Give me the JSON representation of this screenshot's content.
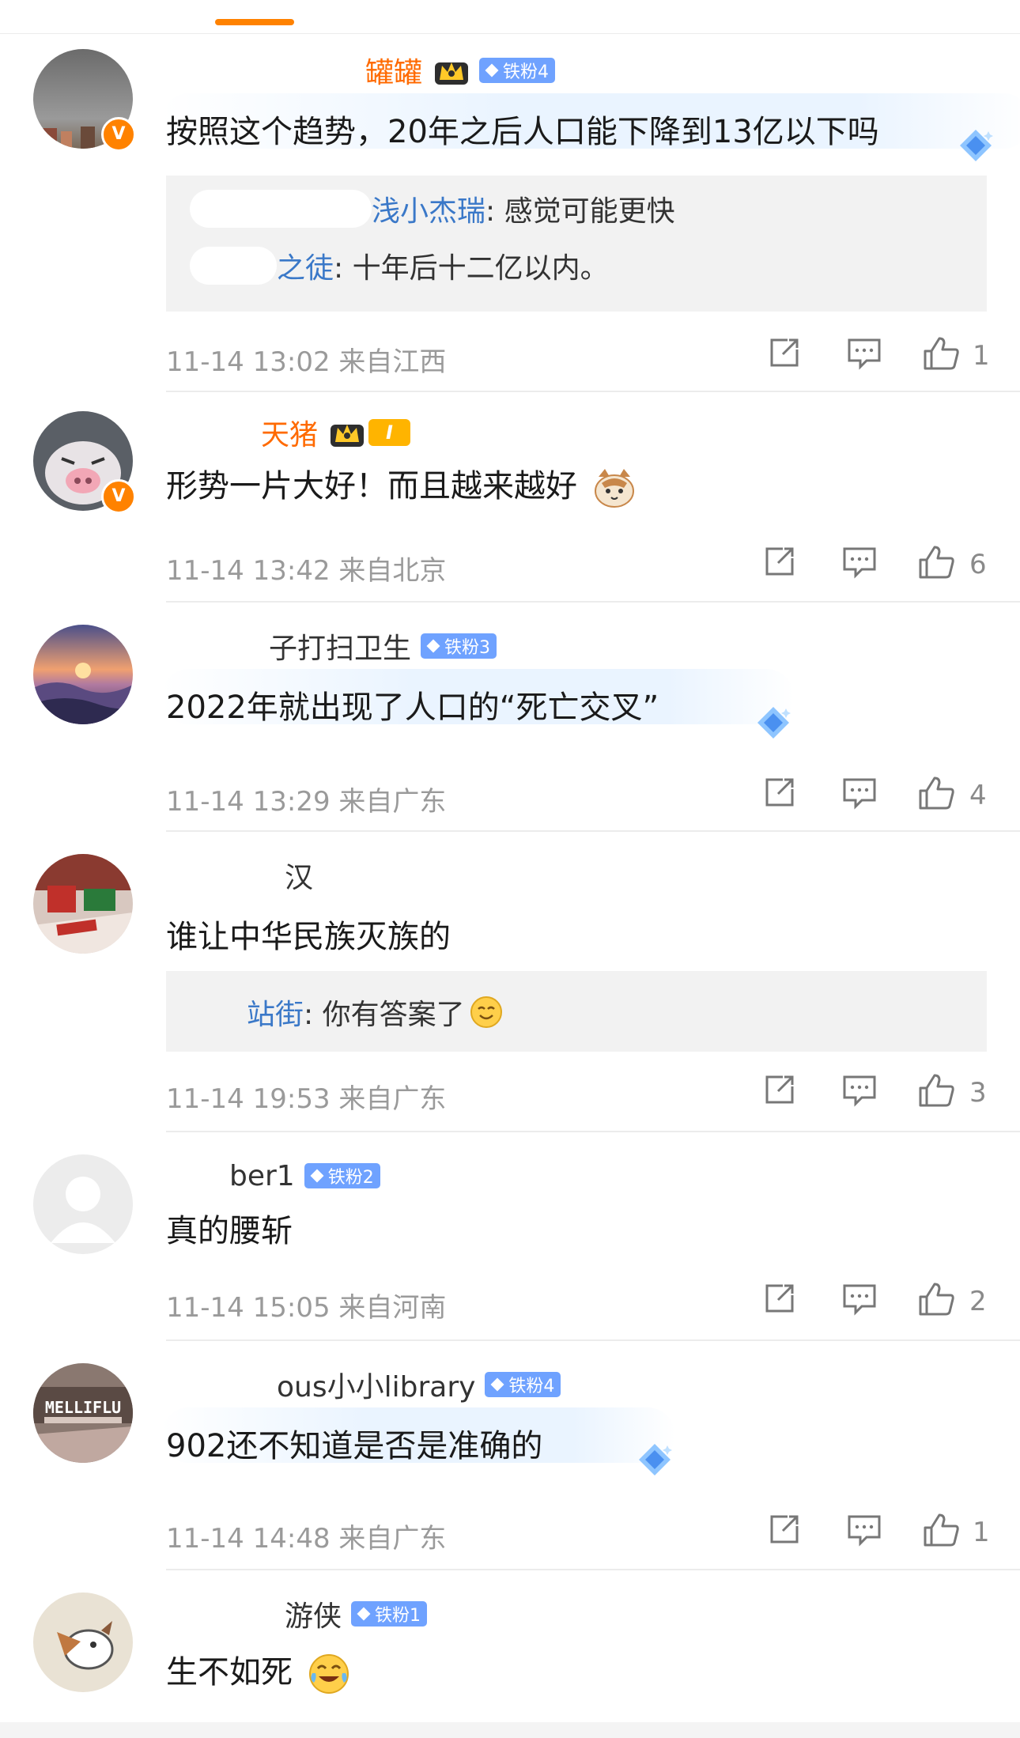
{
  "colors": {
    "accent": "#ff8200",
    "link": "#3a78c8",
    "fan_badge": "#6fa2ff",
    "reply_bg": "#f2f2f2"
  },
  "comments": [
    {
      "username": "罐罐",
      "badges": [
        "铁粉4"
      ],
      "text": "按照这个趋势，20年之后人口能下降到13亿以下吗",
      "replies": [
        {
          "name": "浅小杰瑞",
          "text": ": 感觉可能更快"
        },
        {
          "name": "之徒",
          "text": ": 十年后十二亿以内。"
        }
      ],
      "time": "11-14 13:02",
      "location": "来自江西",
      "likes": "1"
    },
    {
      "username": "天猪",
      "badges": [
        "I"
      ],
      "text": "形势一片大好！而且越来越好",
      "time": "11-14 13:42",
      "location": "来自北京",
      "likes": "6"
    },
    {
      "username": "子打扫卫生",
      "badges": [
        "铁粉3"
      ],
      "text": "2022年就出现了人口的“死亡交叉”",
      "time": "11-14 13:29",
      "location": "来自广东",
      "likes": "4"
    },
    {
      "username": "汉",
      "text": "谁让中华民族灭族的",
      "replies": [
        {
          "name": "站街",
          "text": ": 你有答案了"
        }
      ],
      "time": "11-14 19:53",
      "location": "来自广东",
      "likes": "3"
    },
    {
      "username": "ber1",
      "badges": [
        "铁粉2"
      ],
      "text": "真的腰斩",
      "time": "11-14 15:05",
      "location": "来自河南",
      "likes": "2"
    },
    {
      "username": "ous小小library",
      "badges": [
        "铁粉4"
      ],
      "text": "902还不知道是否是准确的",
      "time": "11-14 14:48",
      "location": "来自广东",
      "likes": "1"
    },
    {
      "username": "游侠",
      "badges": [
        "铁粉1"
      ],
      "text": "生不如死"
    }
  ],
  "icons": {
    "repost": "repost-icon",
    "comment": "comment-icon",
    "like": "like-icon",
    "verified": "verified-icon"
  },
  "verified_mark": "V"
}
